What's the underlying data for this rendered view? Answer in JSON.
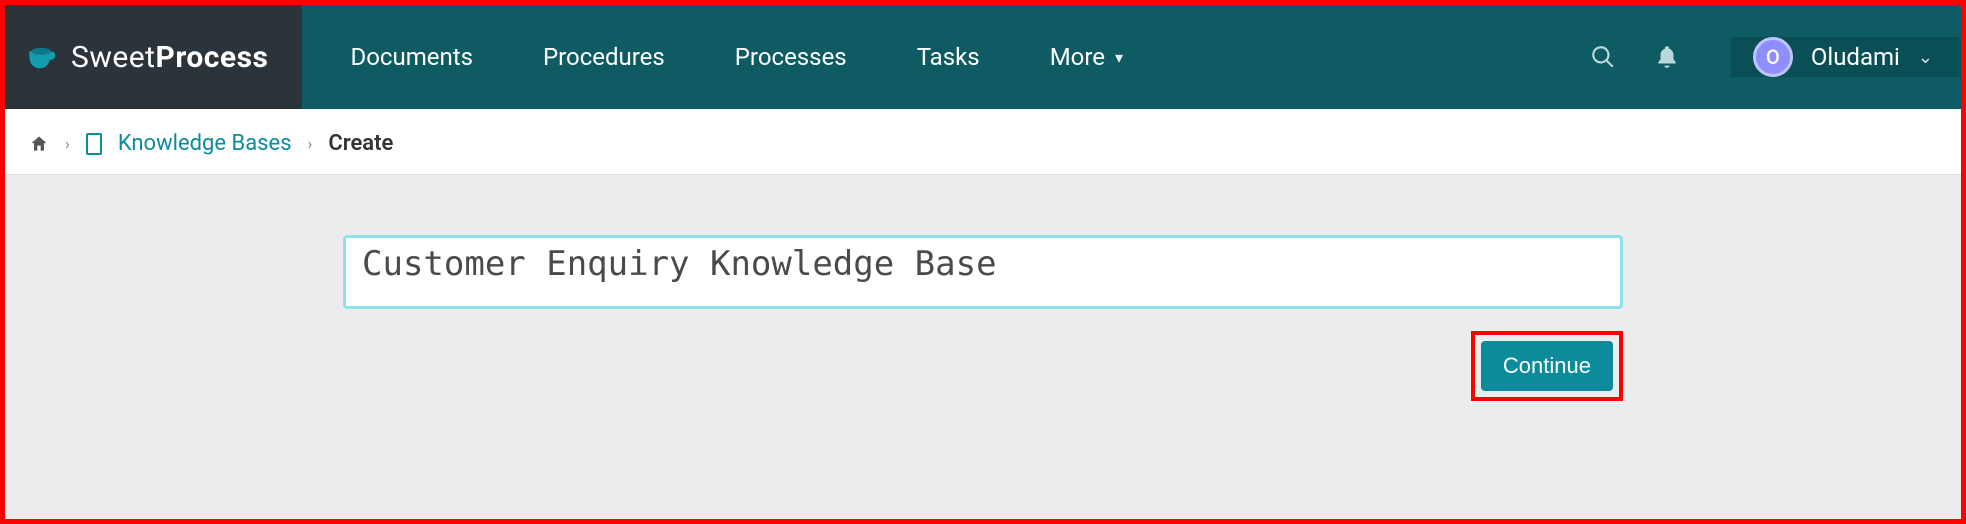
{
  "brand": {
    "name_light": "Sweet",
    "name_bold": "Process"
  },
  "nav": {
    "links": [
      {
        "label": "Documents"
      },
      {
        "label": "Procedures"
      },
      {
        "label": "Processes"
      },
      {
        "label": "Tasks"
      },
      {
        "label": "More",
        "has_dropdown": true
      }
    ]
  },
  "user": {
    "initial": "O",
    "name": "Oludami"
  },
  "breadcrumb": {
    "link_label": "Knowledge Bases",
    "current_label": "Create"
  },
  "form": {
    "name_value": "Customer Enquiry Knowledge Base",
    "continue_label": "Continue"
  }
}
